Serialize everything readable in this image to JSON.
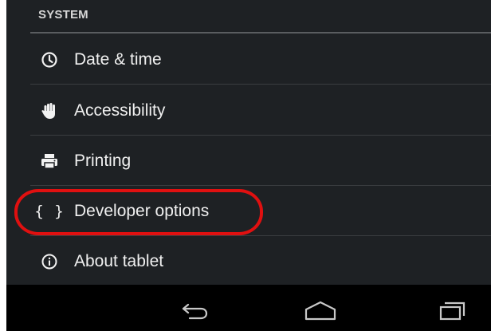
{
  "section": {
    "title": "SYSTEM"
  },
  "items": [
    {
      "label": "Date & time",
      "icon": "clock-icon"
    },
    {
      "label": "Accessibility",
      "icon": "hand-icon"
    },
    {
      "label": "Printing",
      "icon": "printer-icon"
    },
    {
      "label": "Developer options",
      "icon": "braces-icon",
      "icon_text": "{ }"
    },
    {
      "label": "About tablet",
      "icon": "info-icon"
    }
  ],
  "navbar": {
    "buttons": [
      "back-icon",
      "home-icon",
      "recent-apps-icon"
    ]
  },
  "colors": {
    "background": "#1e2124",
    "navbar": "#000000",
    "highlight": "#e01010",
    "text": "#f0f0f0"
  }
}
